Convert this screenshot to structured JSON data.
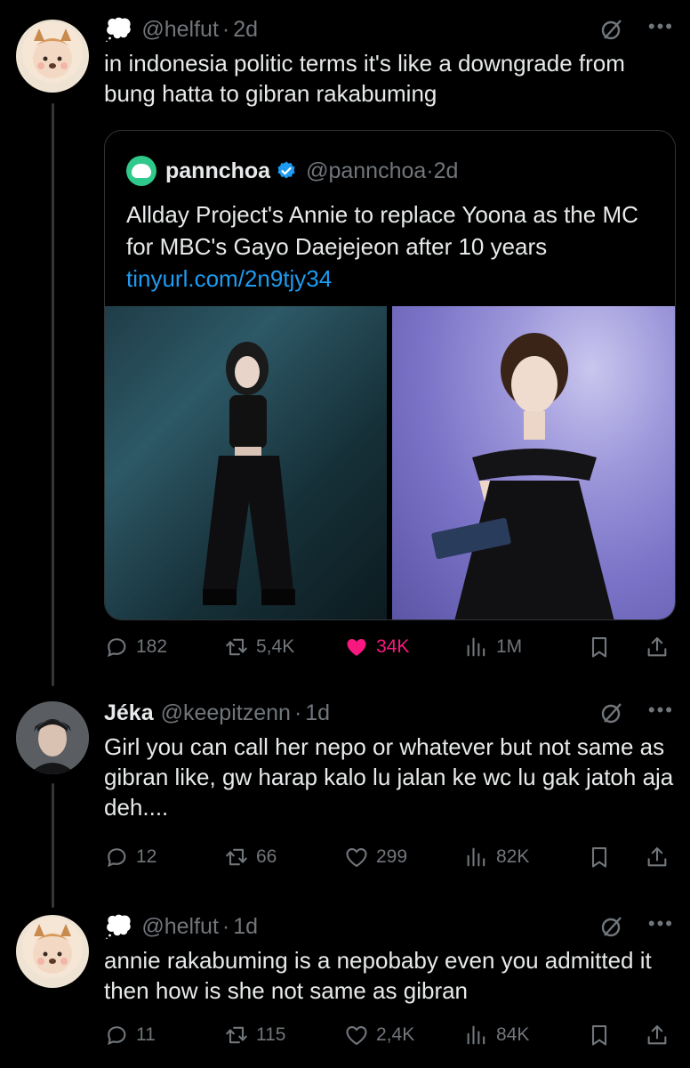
{
  "tweets": [
    {
      "handle": "@helfut",
      "time": "2d",
      "text": "in indonesia politic terms it's like a downgrade from bung hatta to gibran rakabuming",
      "quote": {
        "name": "pannchoa",
        "handle": "@pannchoa",
        "time": "2d",
        "text": "Allday Project's Annie to replace Yoona as the MC for MBC's Gayo Daejejeon after 10 years",
        "link": "tinyurl.com/2n9tjy34"
      },
      "stats": {
        "replies": "182",
        "retweets": "5,4K",
        "likes": "34K",
        "views": "1M"
      }
    },
    {
      "name": "Jéka",
      "handle": "@keepitzenn",
      "time": "1d",
      "text": "Girl you can call her nepo or whatever but not same as gibran like, gw harap kalo lu jalan ke wc lu gak jatoh aja deh....",
      "stats": {
        "replies": "12",
        "retweets": "66",
        "likes": "299",
        "views": "82K"
      }
    },
    {
      "handle": "@helfut",
      "time": "1d",
      "text": "annie rakabuming is a nepobaby even you admitted it then how is she not same as gibran",
      "stats": {
        "replies": "11",
        "retweets": "115",
        "likes": "2,4K",
        "views": "84K"
      }
    }
  ],
  "icons": {
    "cloud": "thought-balloon",
    "more": "more-icon",
    "grok": "grok-icon"
  },
  "colors": {
    "like_active": "#f91880",
    "link": "#1d9bf0",
    "verified": "#1d9bf0"
  }
}
